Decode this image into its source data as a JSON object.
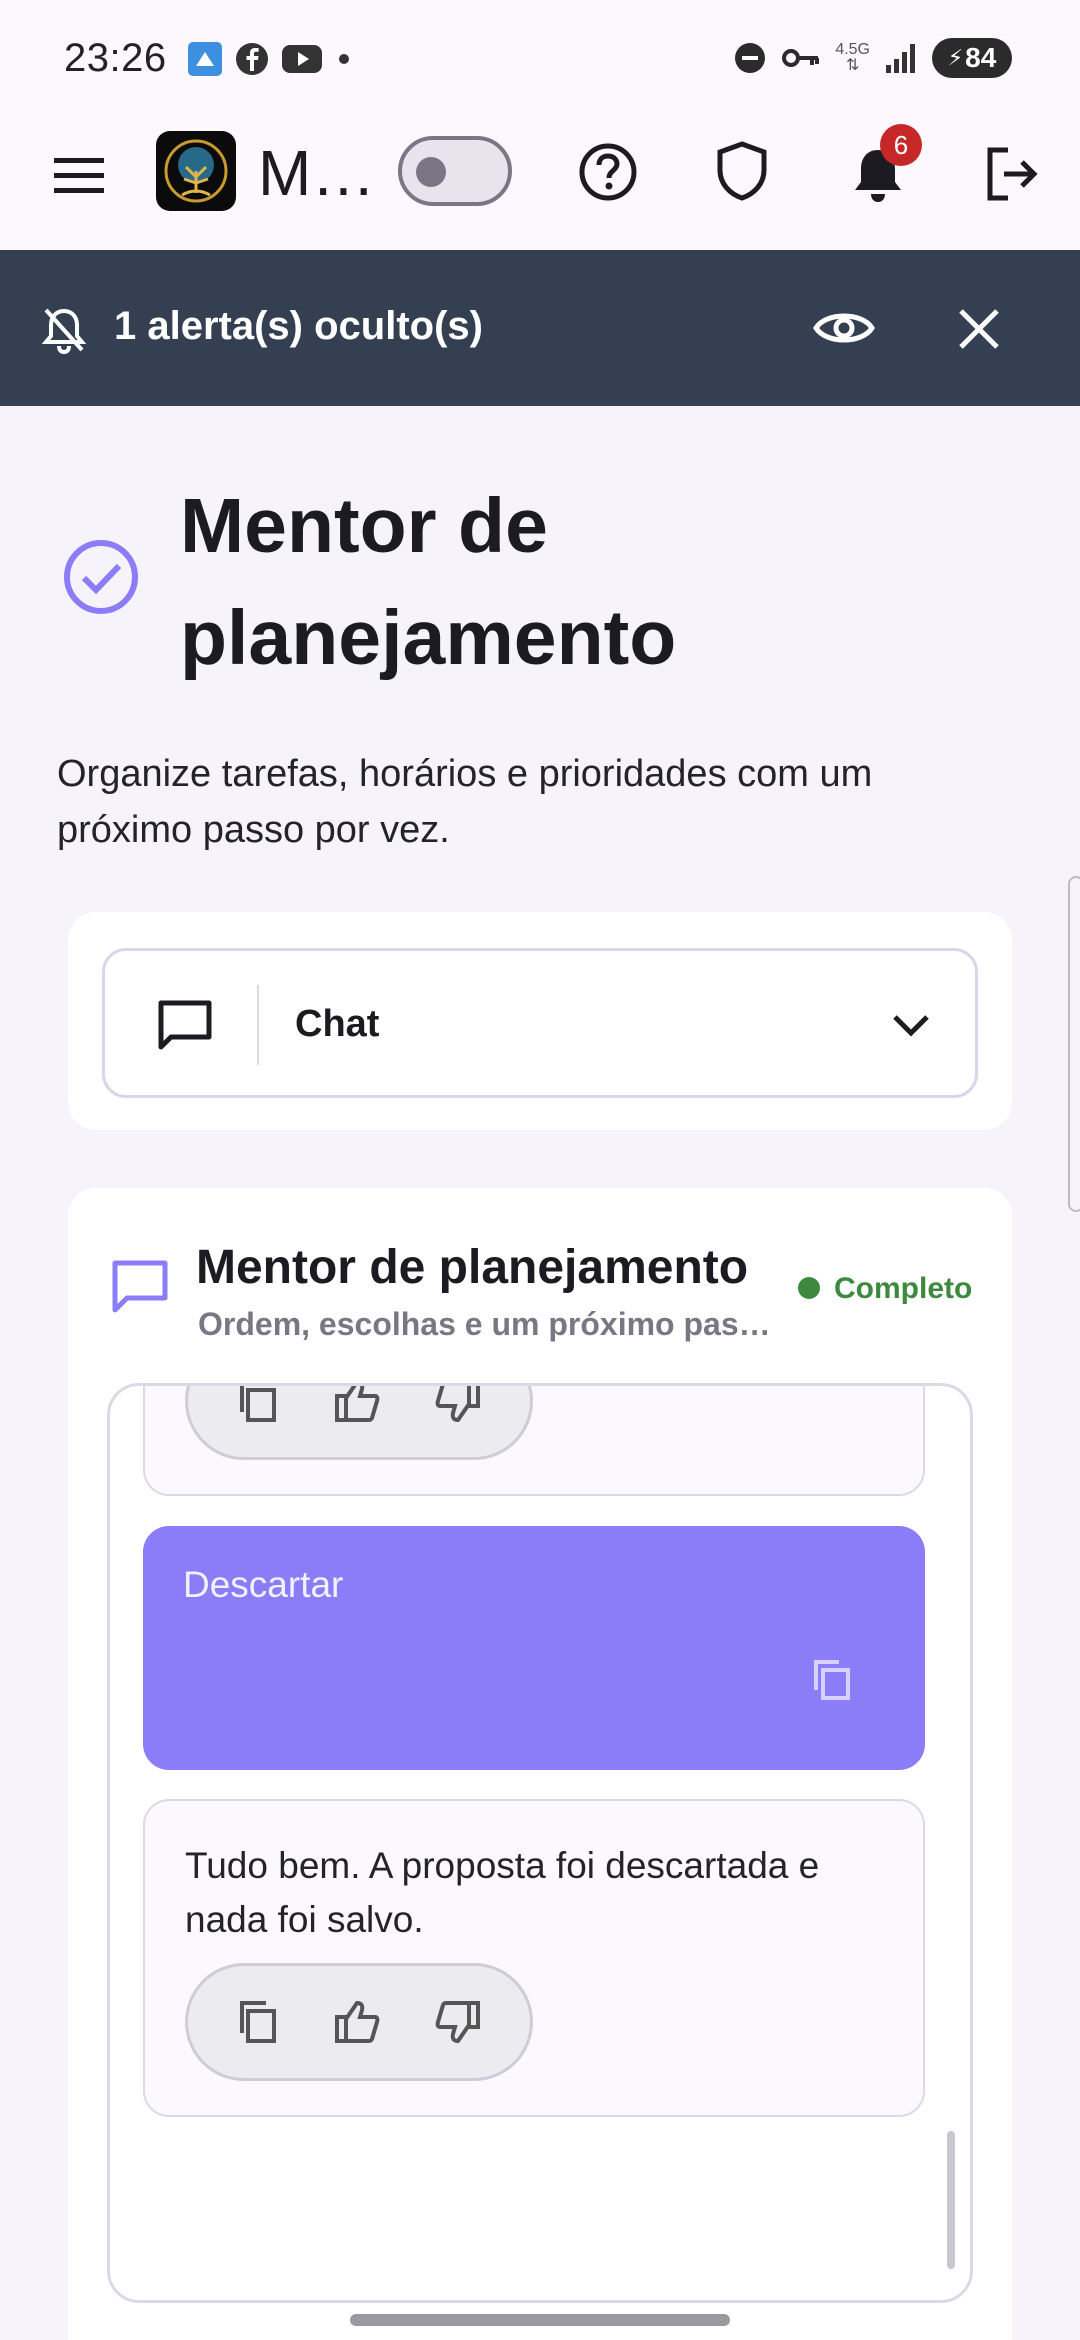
{
  "status_bar": {
    "time": "23:26",
    "network": "4.5G",
    "battery": "84",
    "left_icons": [
      "app-notification-icon",
      "facebook-icon",
      "youtube-icon",
      "dot-icon"
    ],
    "right_icons": [
      "dnd-icon",
      "vpn-key-icon",
      "network-icon",
      "signal-icon",
      "battery-icon"
    ]
  },
  "app_bar": {
    "title": "M…",
    "notification_count": "6",
    "icons": [
      "menu-icon",
      "app-logo",
      "theme-toggle",
      "help-icon",
      "shield-icon",
      "bell-icon",
      "logout-icon"
    ]
  },
  "alert_banner": {
    "text": "1 alerta(s) oculto(s)"
  },
  "page": {
    "title": "Mentor de planejamento",
    "description": "Organize tarefas, horários e prioridades com um próximo passo por vez."
  },
  "mode_select": {
    "value": "Chat"
  },
  "chat": {
    "title": "Mentor de planejamento",
    "subtitle": "Ordem, escolhas e um próximo passo por vez",
    "status": "Completo",
    "messages": [
      {
        "role": "user",
        "text": "Descartar"
      },
      {
        "role": "assistant",
        "text": "Tudo bem. A proposta foi descartada e nada foi salvo."
      }
    ]
  },
  "colors": {
    "banner": "#344052",
    "accent": "#8b7cf8",
    "status": "#3d8a3e",
    "badge": "#c62828"
  }
}
